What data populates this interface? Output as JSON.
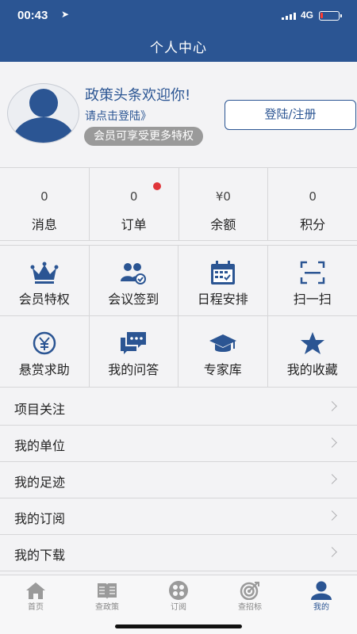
{
  "status": {
    "time": "00:43",
    "network": "4G",
    "battery_level": 0.15
  },
  "nav": {
    "title": "个人中心"
  },
  "profile": {
    "welcome": "政策头条欢迎你!",
    "login_link": "请点击登陆》",
    "vip_badge": "会员可享受更多特权",
    "login_button": "登陆/注册"
  },
  "stats": [
    {
      "value": "0",
      "label": "消息"
    },
    {
      "value": "0",
      "label": "订单"
    },
    {
      "value": "¥0",
      "label": "余额"
    },
    {
      "value": "0",
      "label": "积分"
    }
  ],
  "features": [
    {
      "label": "会员特权",
      "icon": "crown-icon"
    },
    {
      "label": "会议签到",
      "icon": "group-check-icon"
    },
    {
      "label": "日程安排",
      "icon": "calendar-icon"
    },
    {
      "label": "扫一扫",
      "icon": "scan-icon"
    },
    {
      "label": "悬赏求助",
      "icon": "yen-coin-icon"
    },
    {
      "label": "我的问答",
      "icon": "chat-icon"
    },
    {
      "label": "专家库",
      "icon": "graduation-cap-icon"
    },
    {
      "label": "我的收藏",
      "icon": "star-icon"
    }
  ],
  "list": [
    {
      "label": "项目关注"
    },
    {
      "label": "我的单位"
    },
    {
      "label": "我的足迹"
    },
    {
      "label": "我的订阅"
    },
    {
      "label": "我的下载"
    }
  ],
  "tabs": [
    {
      "label": "首页",
      "icon": "home-icon"
    },
    {
      "label": "查政策",
      "icon": "book-icon"
    },
    {
      "label": "订阅",
      "icon": "subscribe-icon"
    },
    {
      "label": "查招标",
      "icon": "target-icon"
    },
    {
      "label": "我的",
      "icon": "user-icon"
    }
  ],
  "colors": {
    "primary": "#2b5593",
    "background": "#f3f3f5",
    "badge_dot": "#e0353a",
    "tab_inactive": "#888888"
  }
}
